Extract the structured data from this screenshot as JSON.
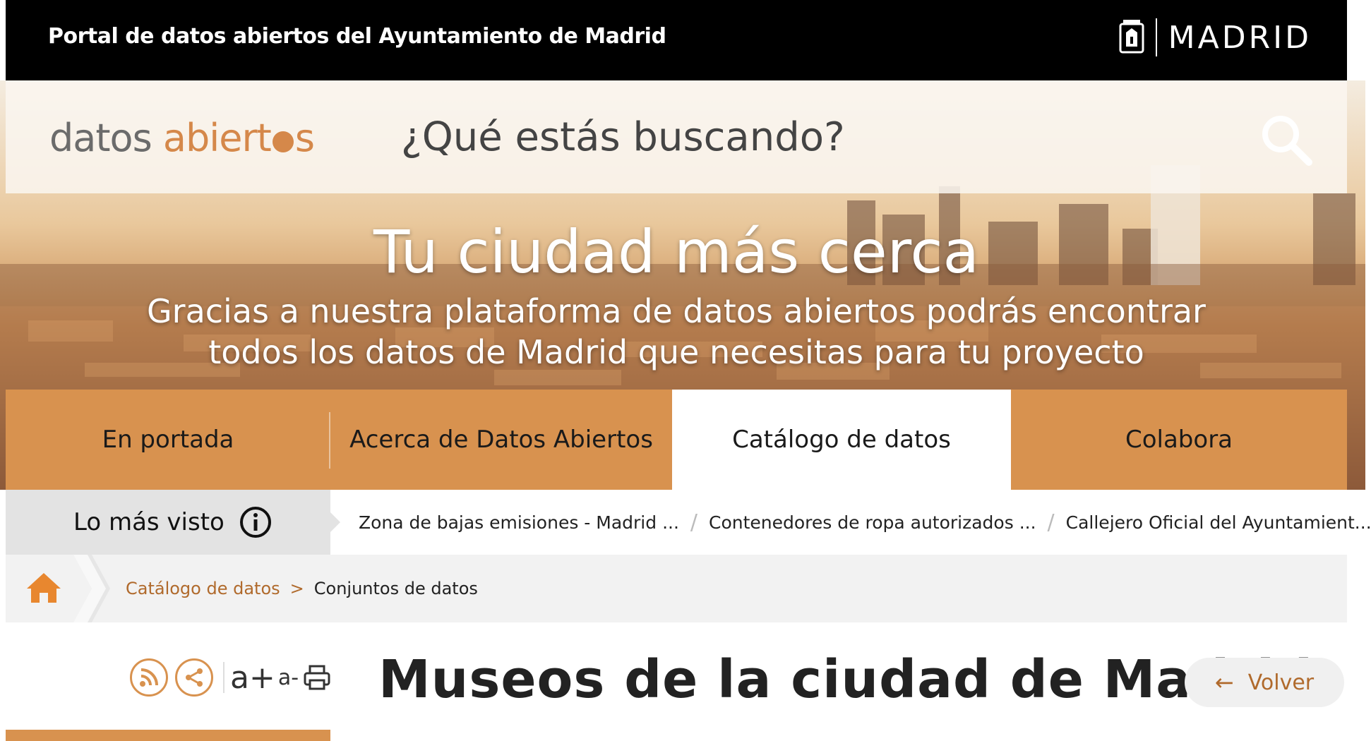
{
  "header": {
    "portal_title": "Portal de datos abiertos del Ayuntamiento de Madrid",
    "logo_text": "MADRID"
  },
  "search": {
    "brand_part1": "datos",
    "brand_part2a": "abiert",
    "brand_part2b": "s",
    "placeholder": "¿Qué estás buscando?"
  },
  "hero": {
    "title": "Tu ciudad más cerca",
    "subtitle_line1": "Gracias a nuestra plataforma de datos abiertos podrás encontrar",
    "subtitle_line2": "todos los datos de Madrid que necesitas para tu proyecto"
  },
  "nav": {
    "items": [
      {
        "label": "En portada"
      },
      {
        "label": "Acerca de Datos Abiertos"
      },
      {
        "label": "Catálogo de datos"
      },
      {
        "label": "Colabora"
      }
    ]
  },
  "most_viewed": {
    "label": "Lo más visto",
    "links": [
      {
        "label": "Zona de bajas emisiones - Madrid ..."
      },
      {
        "label": "Contenedores de ropa autorizados ..."
      },
      {
        "label": "Callejero Oficial del Ayuntamient..."
      }
    ],
    "separator": "/"
  },
  "breadcrumb": {
    "items": [
      {
        "label": "Catálogo de datos"
      },
      {
        "label": "Conjuntos de datos"
      }
    ],
    "separator": ">"
  },
  "content": {
    "title": "Museos de la ciudad de Madrid",
    "font_increase": "a+",
    "font_decrease": "a-",
    "back_label": "Volver",
    "back_arrow": "←"
  },
  "colors": {
    "accent": "#d8924f",
    "link": "#b06a2c",
    "brand_gray": "#6b6b6b"
  },
  "icons": [
    "madrid-crest-icon",
    "search-icon",
    "info-icon",
    "home-icon",
    "rss-icon",
    "share-icon",
    "print-icon",
    "arrow-left-icon"
  ]
}
